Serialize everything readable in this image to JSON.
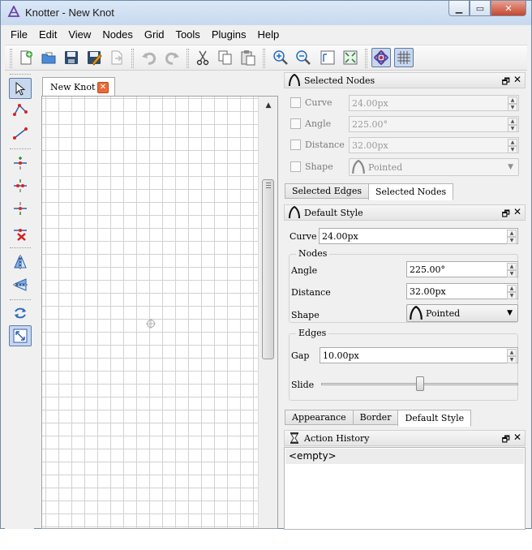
{
  "window": {
    "title": "Knotter - New Knot",
    "controls": {
      "minimize": "▁",
      "maximize": "▭",
      "close": "✕"
    }
  },
  "menu": [
    "File",
    "Edit",
    "View",
    "Nodes",
    "Grid",
    "Tools",
    "Plugins",
    "Help"
  ],
  "toolbar": {
    "buttons": [
      "new-file-icon",
      "open-file-icon",
      "save-icon",
      "save-as-icon",
      "export-icon",
      "undo-icon",
      "redo-icon",
      "cut-icon",
      "copy-icon",
      "paste-icon",
      "zoom-in-icon",
      "zoom-out-icon",
      "zoom-fit-icon",
      "zoom-reset-icon",
      "knot-view-icon",
      "grid-view-icon"
    ],
    "active": [
      "knot-view-icon",
      "grid-view-icon"
    ]
  },
  "tools": {
    "items": [
      "select-tool-icon",
      "edge-loop-tool-icon",
      "edge-chain-tool-icon",
      "insert-node-tool-icon",
      "merge-node-tool-icon",
      "break-edge-tool-icon",
      "remove-edge-tool-icon",
      "flip-horizontal-tool-icon",
      "flip-vertical-tool-icon",
      "rotate-tool-icon",
      "scale-tool-icon"
    ],
    "active": [
      "select-tool-icon",
      "scale-tool-icon"
    ]
  },
  "document": {
    "tab_label": "New Knot",
    "tab_close": "✕"
  },
  "selected_nodes": {
    "title": "Selected Nodes",
    "curve_label": "Curve",
    "curve_value": "24.00px",
    "angle_label": "Angle",
    "angle_value": "225.00°",
    "distance_label": "Distance",
    "distance_value": "32.00px",
    "shape_label": "Shape",
    "shape_value": "Pointed"
  },
  "upper_tabs": [
    "Selected Edges",
    "Selected Nodes"
  ],
  "default_style": {
    "title": "Default Style",
    "curve_label": "Curve",
    "curve_value": "24.00px",
    "nodes_group": "Nodes",
    "angle_label": "Angle",
    "angle_value": "225.00°",
    "distance_label": "Distance",
    "distance_value": "32.00px",
    "shape_label": "Shape",
    "shape_value": "Pointed",
    "edges_group": "Edges",
    "gap_label": "Gap",
    "gap_value": "10.00px",
    "slide_label": "Slide",
    "slide_fraction": 0.5
  },
  "lower_tabs": [
    "Appearance",
    "Border",
    "Default Style"
  ],
  "action_history": {
    "title": "Action History",
    "items": [
      "<empty>"
    ]
  },
  "dock_controls": {
    "float": "🗗",
    "close": "✕"
  }
}
